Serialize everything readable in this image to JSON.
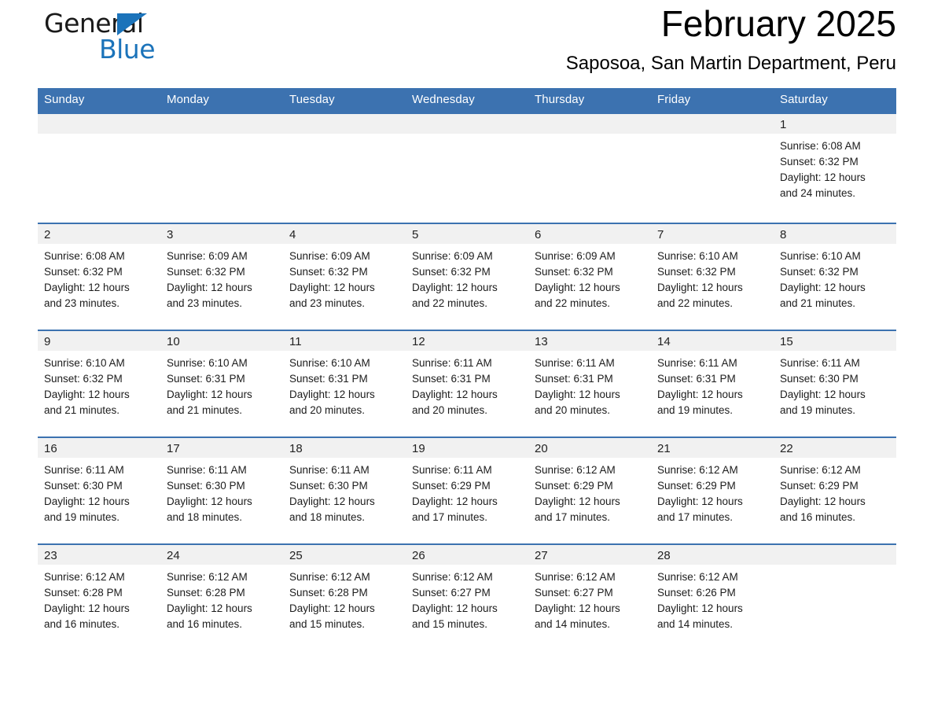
{
  "brand": {
    "name_part1": "General",
    "name_part2": "Blue",
    "triangle_color": "#1b73ba"
  },
  "header": {
    "month_title": "February 2025",
    "location": "Saposoa, San Martin Department, Peru"
  },
  "theme": {
    "header_blue": "#3c72b0",
    "row_divider_blue": "#3c72b0",
    "daynum_band_gray": "#f1f1f1"
  },
  "calendar": {
    "weekday_headers": [
      "Sunday",
      "Monday",
      "Tuesday",
      "Wednesday",
      "Thursday",
      "Friday",
      "Saturday"
    ],
    "weeks": [
      [
        {
          "day": "",
          "sunrise": "",
          "sunset": "",
          "daylight_line1": "",
          "daylight_line2": ""
        },
        {
          "day": "",
          "sunrise": "",
          "sunset": "",
          "daylight_line1": "",
          "daylight_line2": ""
        },
        {
          "day": "",
          "sunrise": "",
          "sunset": "",
          "daylight_line1": "",
          "daylight_line2": ""
        },
        {
          "day": "",
          "sunrise": "",
          "sunset": "",
          "daylight_line1": "",
          "daylight_line2": ""
        },
        {
          "day": "",
          "sunrise": "",
          "sunset": "",
          "daylight_line1": "",
          "daylight_line2": ""
        },
        {
          "day": "",
          "sunrise": "",
          "sunset": "",
          "daylight_line1": "",
          "daylight_line2": ""
        },
        {
          "day": "1",
          "sunrise": "Sunrise: 6:08 AM",
          "sunset": "Sunset: 6:32 PM",
          "daylight_line1": "Daylight: 12 hours",
          "daylight_line2": "and 24 minutes."
        }
      ],
      [
        {
          "day": "2",
          "sunrise": "Sunrise: 6:08 AM",
          "sunset": "Sunset: 6:32 PM",
          "daylight_line1": "Daylight: 12 hours",
          "daylight_line2": "and 23 minutes."
        },
        {
          "day": "3",
          "sunrise": "Sunrise: 6:09 AM",
          "sunset": "Sunset: 6:32 PM",
          "daylight_line1": "Daylight: 12 hours",
          "daylight_line2": "and 23 minutes."
        },
        {
          "day": "4",
          "sunrise": "Sunrise: 6:09 AM",
          "sunset": "Sunset: 6:32 PM",
          "daylight_line1": "Daylight: 12 hours",
          "daylight_line2": "and 23 minutes."
        },
        {
          "day": "5",
          "sunrise": "Sunrise: 6:09 AM",
          "sunset": "Sunset: 6:32 PM",
          "daylight_line1": "Daylight: 12 hours",
          "daylight_line2": "and 22 minutes."
        },
        {
          "day": "6",
          "sunrise": "Sunrise: 6:09 AM",
          "sunset": "Sunset: 6:32 PM",
          "daylight_line1": "Daylight: 12 hours",
          "daylight_line2": "and 22 minutes."
        },
        {
          "day": "7",
          "sunrise": "Sunrise: 6:10 AM",
          "sunset": "Sunset: 6:32 PM",
          "daylight_line1": "Daylight: 12 hours",
          "daylight_line2": "and 22 minutes."
        },
        {
          "day": "8",
          "sunrise": "Sunrise: 6:10 AM",
          "sunset": "Sunset: 6:32 PM",
          "daylight_line1": "Daylight: 12 hours",
          "daylight_line2": "and 21 minutes."
        }
      ],
      [
        {
          "day": "9",
          "sunrise": "Sunrise: 6:10 AM",
          "sunset": "Sunset: 6:32 PM",
          "daylight_line1": "Daylight: 12 hours",
          "daylight_line2": "and 21 minutes."
        },
        {
          "day": "10",
          "sunrise": "Sunrise: 6:10 AM",
          "sunset": "Sunset: 6:31 PM",
          "daylight_line1": "Daylight: 12 hours",
          "daylight_line2": "and 21 minutes."
        },
        {
          "day": "11",
          "sunrise": "Sunrise: 6:10 AM",
          "sunset": "Sunset: 6:31 PM",
          "daylight_line1": "Daylight: 12 hours",
          "daylight_line2": "and 20 minutes."
        },
        {
          "day": "12",
          "sunrise": "Sunrise: 6:11 AM",
          "sunset": "Sunset: 6:31 PM",
          "daylight_line1": "Daylight: 12 hours",
          "daylight_line2": "and 20 minutes."
        },
        {
          "day": "13",
          "sunrise": "Sunrise: 6:11 AM",
          "sunset": "Sunset: 6:31 PM",
          "daylight_line1": "Daylight: 12 hours",
          "daylight_line2": "and 20 minutes."
        },
        {
          "day": "14",
          "sunrise": "Sunrise: 6:11 AM",
          "sunset": "Sunset: 6:31 PM",
          "daylight_line1": "Daylight: 12 hours",
          "daylight_line2": "and 19 minutes."
        },
        {
          "day": "15",
          "sunrise": "Sunrise: 6:11 AM",
          "sunset": "Sunset: 6:30 PM",
          "daylight_line1": "Daylight: 12 hours",
          "daylight_line2": "and 19 minutes."
        }
      ],
      [
        {
          "day": "16",
          "sunrise": "Sunrise: 6:11 AM",
          "sunset": "Sunset: 6:30 PM",
          "daylight_line1": "Daylight: 12 hours",
          "daylight_line2": "and 19 minutes."
        },
        {
          "day": "17",
          "sunrise": "Sunrise: 6:11 AM",
          "sunset": "Sunset: 6:30 PM",
          "daylight_line1": "Daylight: 12 hours",
          "daylight_line2": "and 18 minutes."
        },
        {
          "day": "18",
          "sunrise": "Sunrise: 6:11 AM",
          "sunset": "Sunset: 6:30 PM",
          "daylight_line1": "Daylight: 12 hours",
          "daylight_line2": "and 18 minutes."
        },
        {
          "day": "19",
          "sunrise": "Sunrise: 6:11 AM",
          "sunset": "Sunset: 6:29 PM",
          "daylight_line1": "Daylight: 12 hours",
          "daylight_line2": "and 17 minutes."
        },
        {
          "day": "20",
          "sunrise": "Sunrise: 6:12 AM",
          "sunset": "Sunset: 6:29 PM",
          "daylight_line1": "Daylight: 12 hours",
          "daylight_line2": "and 17 minutes."
        },
        {
          "day": "21",
          "sunrise": "Sunrise: 6:12 AM",
          "sunset": "Sunset: 6:29 PM",
          "daylight_line1": "Daylight: 12 hours",
          "daylight_line2": "and 17 minutes."
        },
        {
          "day": "22",
          "sunrise": "Sunrise: 6:12 AM",
          "sunset": "Sunset: 6:29 PM",
          "daylight_line1": "Daylight: 12 hours",
          "daylight_line2": "and 16 minutes."
        }
      ],
      [
        {
          "day": "23",
          "sunrise": "Sunrise: 6:12 AM",
          "sunset": "Sunset: 6:28 PM",
          "daylight_line1": "Daylight: 12 hours",
          "daylight_line2": "and 16 minutes."
        },
        {
          "day": "24",
          "sunrise": "Sunrise: 6:12 AM",
          "sunset": "Sunset: 6:28 PM",
          "daylight_line1": "Daylight: 12 hours",
          "daylight_line2": "and 16 minutes."
        },
        {
          "day": "25",
          "sunrise": "Sunrise: 6:12 AM",
          "sunset": "Sunset: 6:28 PM",
          "daylight_line1": "Daylight: 12 hours",
          "daylight_line2": "and 15 minutes."
        },
        {
          "day": "26",
          "sunrise": "Sunrise: 6:12 AM",
          "sunset": "Sunset: 6:27 PM",
          "daylight_line1": "Daylight: 12 hours",
          "daylight_line2": "and 15 minutes."
        },
        {
          "day": "27",
          "sunrise": "Sunrise: 6:12 AM",
          "sunset": "Sunset: 6:27 PM",
          "daylight_line1": "Daylight: 12 hours",
          "daylight_line2": "and 14 minutes."
        },
        {
          "day": "28",
          "sunrise": "Sunrise: 6:12 AM",
          "sunset": "Sunset: 6:26 PM",
          "daylight_line1": "Daylight: 12 hours",
          "daylight_line2": "and 14 minutes."
        },
        {
          "day": "",
          "sunrise": "",
          "sunset": "",
          "daylight_line1": "",
          "daylight_line2": ""
        }
      ]
    ]
  }
}
